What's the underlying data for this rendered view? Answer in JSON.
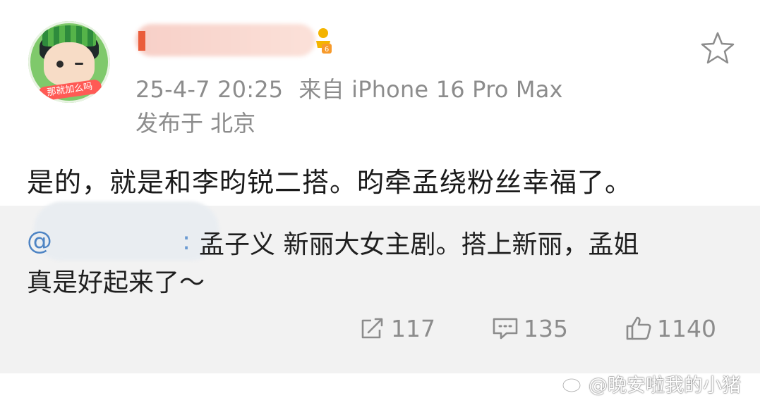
{
  "post": {
    "author_avatar_label": "那就加么吗",
    "time": "25-4-7 20:25",
    "source": "来自 iPhone 16 Pro Max",
    "location": "发布于 北京",
    "text": "是的，就是和李昀锐二搭。昀牵孟绕粉丝幸福了。"
  },
  "repost": {
    "at_symbol": "@",
    "mention_tail": ":",
    "line1": "孟子义 新丽大女主剧。搭上新丽，孟姐",
    "line2": "真是好起来了～"
  },
  "actions": {
    "repost_count": "117",
    "comment_count": "135",
    "like_count": "1140"
  },
  "watermark": {
    "text": "@晚安啦我的小猪"
  },
  "colors": {
    "meta_gray": "#8c8c8c",
    "repost_bg": "#f2f2f2",
    "mention_blue": "#4e84c4",
    "avatar_green": "#7fc96b"
  }
}
